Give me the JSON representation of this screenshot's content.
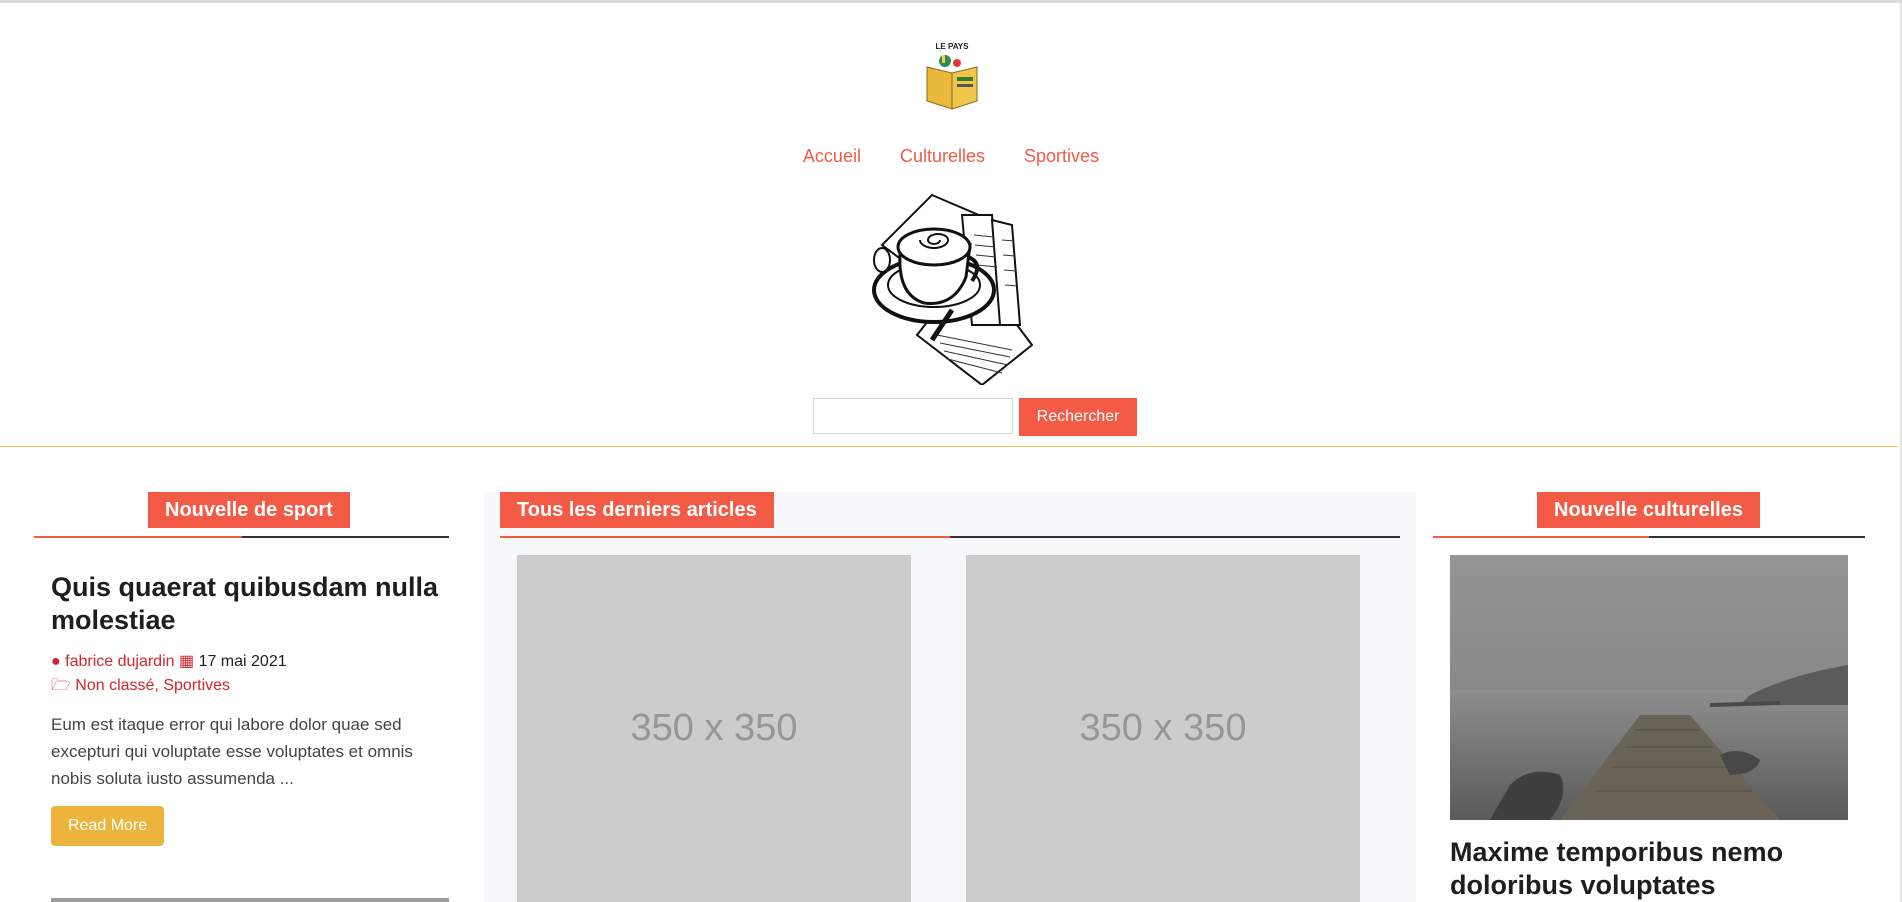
{
  "header": {
    "logo_text": "LE PAYS",
    "nav": [
      "Accueil",
      "Culturelles",
      "Sportives"
    ],
    "search": {
      "value": "",
      "button_label": "Rechercher"
    }
  },
  "left": {
    "section_title": "Nouvelle de sport",
    "post": {
      "title": "Quis quaerat quibusdam nulla molestiae",
      "author": "fabrice dujardin",
      "date": "17 mai 2021",
      "categories": "Non classé, Sportives",
      "excerpt": "Eum est itaque error qui labore dolor quae sed excepturi qui voluptate esse voluptates et omnis nobis soluta iusto assumenda ...",
      "read_more": "Read More"
    }
  },
  "middle": {
    "section_title": "Tous les derniers articles",
    "placeholders": [
      "350 x 350",
      "350 x 350"
    ]
  },
  "right": {
    "section_title": "Nouvelle culturelles",
    "post_title": "Maxime temporibus nemo doloribus voluptates"
  },
  "colors": {
    "accent": "#f35b47",
    "button_yellow": "#ecb43c",
    "meta_red": "#d0252b"
  }
}
